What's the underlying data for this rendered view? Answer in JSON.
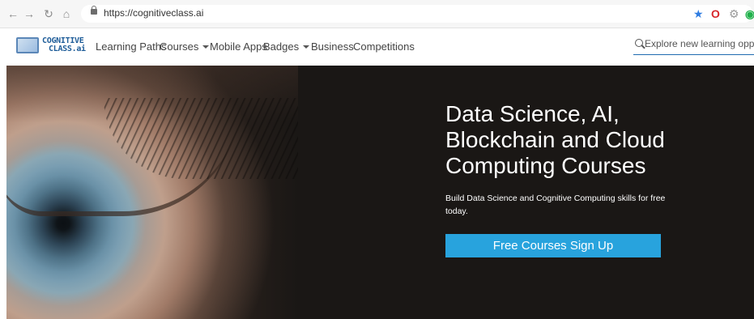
{
  "browser": {
    "url": "https://cognitiveclass.ai",
    "icons": [
      "back-icon",
      "forward-icon",
      "reload-icon",
      "home-icon",
      "lock-icon",
      "star-icon",
      "opera-icon",
      "extension-icon",
      "grammarly-icon"
    ]
  },
  "logo": {
    "line1": "COGNITIVE",
    "line2": "CLASS.ai"
  },
  "nav": {
    "learning_paths": "Learning Paths",
    "courses": "Courses",
    "mobile_apps": "Mobile Apps",
    "badges": "Badges",
    "business": "Business",
    "competitions": "Competitions"
  },
  "search": {
    "placeholder": "Explore new learning opportunities"
  },
  "hero": {
    "title": "Data Science, AI, Blockchain and Cloud Computing Courses",
    "subtitle": "Build Data Science and Cognitive Computing skills for free today.",
    "cta_label": "Free Courses Sign Up"
  },
  "colors": {
    "accent": "#28a3dd",
    "hero_bg": "#1a1715",
    "nav_text": "#444444",
    "search_underline": "#1f6bb0"
  }
}
